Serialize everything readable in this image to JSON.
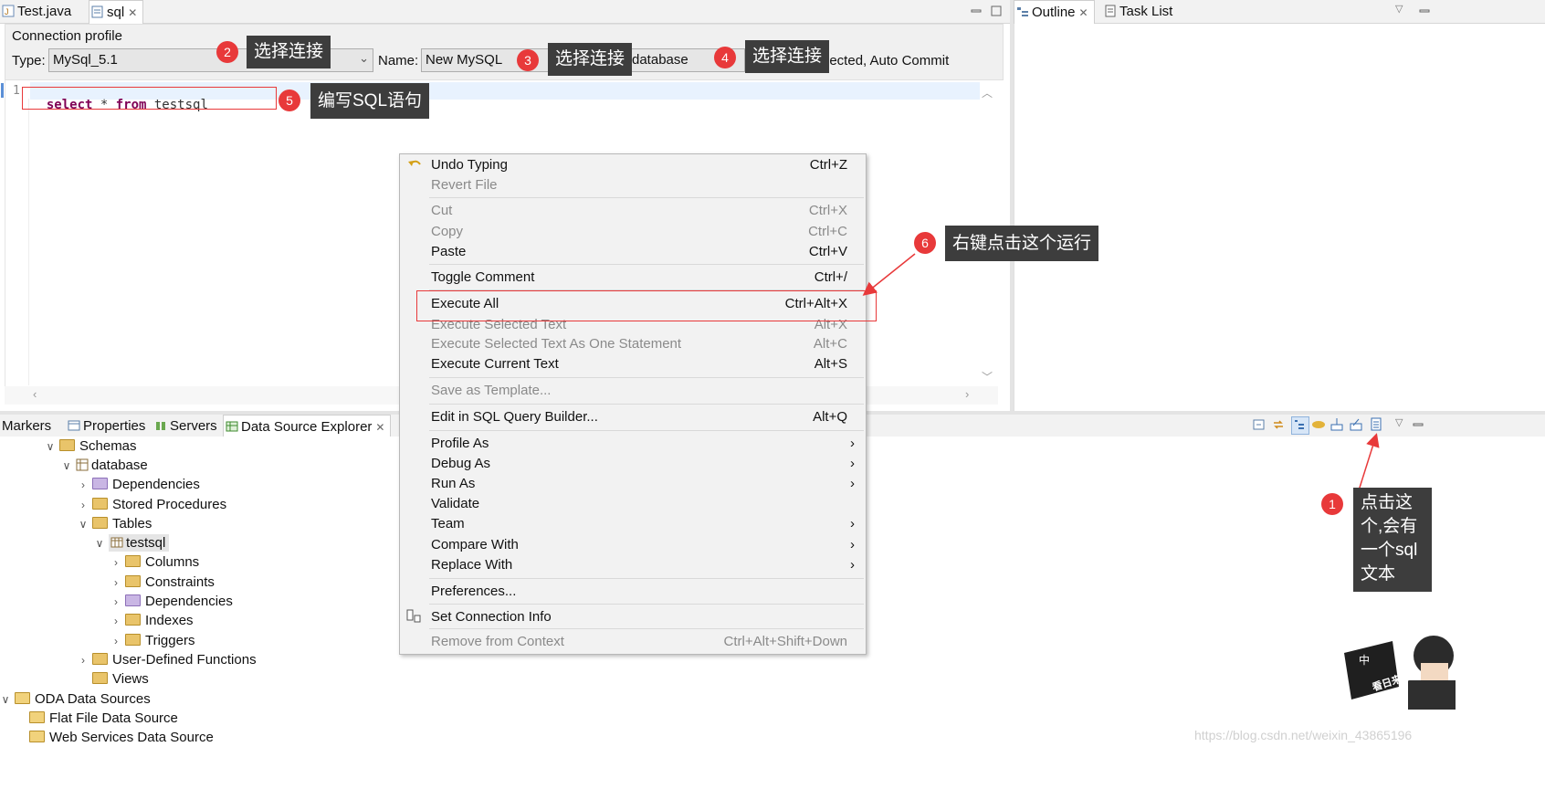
{
  "editor_tabs": [
    {
      "label": "Test.java"
    },
    {
      "label": "sql"
    }
  ],
  "connection": {
    "section_title": "Connection profile",
    "type_label": "Type:",
    "type_value": "MySql_5.1",
    "name_label": "Name:",
    "name_value": "New MySQL",
    "database_value": "database",
    "status_text": "nected, Auto Commit"
  },
  "editor": {
    "line_number": "1",
    "kw_select": "select",
    "star": " * ",
    "kw_from": "from",
    "table": " testsql"
  },
  "right_tabs": [
    {
      "label": "Outline"
    },
    {
      "label": "Task List"
    }
  ],
  "bottom_tabs": [
    {
      "label": "Markers"
    },
    {
      "label": "Properties"
    },
    {
      "label": "Servers"
    },
    {
      "label": "Data Source Explorer"
    }
  ],
  "tree": [
    {
      "label": "Schemas"
    },
    {
      "label": "database"
    },
    {
      "label": "Dependencies"
    },
    {
      "label": "Stored Procedures"
    },
    {
      "label": "Tables"
    },
    {
      "label": "testsql"
    },
    {
      "label": "Columns"
    },
    {
      "label": "Constraints"
    },
    {
      "label": "Dependencies"
    },
    {
      "label": "Indexes"
    },
    {
      "label": "Triggers"
    },
    {
      "label": "User-Defined Functions"
    },
    {
      "label": "Views"
    },
    {
      "label": "ODA Data Sources"
    },
    {
      "label": "Flat File Data Source"
    },
    {
      "label": "Web Services Data Source"
    }
  ],
  "context_menu": [
    {
      "label": "Undo Typing",
      "shortcut": "Ctrl+Z"
    },
    {
      "label": "Revert File",
      "shortcut": ""
    },
    {
      "label": "Cut",
      "shortcut": "Ctrl+X"
    },
    {
      "label": "Copy",
      "shortcut": "Ctrl+C"
    },
    {
      "label": "Paste",
      "shortcut": "Ctrl+V"
    },
    {
      "label": "Toggle Comment",
      "shortcut": "Ctrl+/"
    },
    {
      "label": "Execute All",
      "shortcut": "Ctrl+Alt+X"
    },
    {
      "label": "Execute Selected Text",
      "shortcut": "Alt+X"
    },
    {
      "label": "Execute Selected Text As One Statement",
      "shortcut": "Alt+C"
    },
    {
      "label": "Execute Current Text",
      "shortcut": "Alt+S"
    },
    {
      "label": "Save as Template...",
      "shortcut": ""
    },
    {
      "label": "Edit in SQL Query Builder...",
      "shortcut": "Alt+Q"
    },
    {
      "label": "Profile As",
      "shortcut": "›"
    },
    {
      "label": "Debug As",
      "shortcut": "›"
    },
    {
      "label": "Run As",
      "shortcut": "›"
    },
    {
      "label": "Validate",
      "shortcut": ""
    },
    {
      "label": "Team",
      "shortcut": "›"
    },
    {
      "label": "Compare With",
      "shortcut": "›"
    },
    {
      "label": "Replace With",
      "shortcut": "›"
    },
    {
      "label": "Preferences...",
      "shortcut": ""
    },
    {
      "label": "Set Connection Info",
      "shortcut": ""
    },
    {
      "label": "Remove from Context",
      "shortcut": "Ctrl+Alt+Shift+Down"
    }
  ],
  "annotations": {
    "b1": "1",
    "b2": "2",
    "b3": "3",
    "b4": "4",
    "b5": "5",
    "b6": "6",
    "c2": "选择连接",
    "c3": "选择连接",
    "c4": "选择连接",
    "c5": "编写SQL语句",
    "c6": "右键点击这个运行",
    "c1_l1": "点击这",
    "c1_l2": "个,会有",
    "c1_l3": "一个sql",
    "c1_l4": "文本"
  },
  "mascot": {
    "bubble": "中",
    "caption": "看日来那"
  },
  "watermark": "https://blog.csdn.net/weixin_43865196",
  "colors": {
    "accent_red": "#e8393a",
    "callout_bg": "#3d3d3d",
    "keyword": "#7f0055"
  }
}
